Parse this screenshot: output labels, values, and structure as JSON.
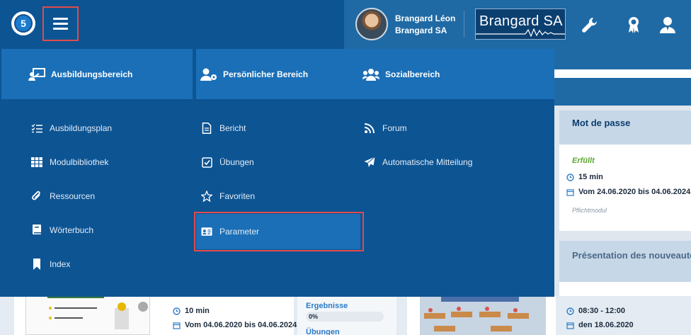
{
  "header": {
    "logo_number": "5",
    "user": {
      "name": "Brangard Léon",
      "company": "Brangard SA"
    },
    "brand_logo_text": "Brangard SA"
  },
  "menu": {
    "tabs": [
      {
        "label": "Ausbildungsbereich",
        "icon": "classroom-icon"
      },
      {
        "label": "Persönlicher Bereich",
        "icon": "user-settings-icon"
      },
      {
        "label": "Sozialbereich",
        "icon": "users-group-icon"
      }
    ],
    "columns": [
      [
        {
          "label": "Ausbildungsplan",
          "icon": "checklist-icon"
        },
        {
          "label": "Modulbibliothek",
          "icon": "grid-icon"
        },
        {
          "label": "Ressourcen",
          "icon": "paperclip-icon"
        },
        {
          "label": "Wörterbuch",
          "icon": "book-icon"
        },
        {
          "label": "Index",
          "icon": "bookmark-icon"
        }
      ],
      [
        {
          "label": "Bericht",
          "icon": "document-icon"
        },
        {
          "label": "Übungen",
          "icon": "checkbox-icon"
        },
        {
          "label": "Favoriten",
          "icon": "star-icon"
        },
        {
          "label": "Parameter",
          "icon": "id-card-icon",
          "selected": true
        }
      ],
      [
        {
          "label": "Forum",
          "icon": "rss-icon"
        },
        {
          "label": "Automatische Mitteilung",
          "icon": "paper-plane-icon"
        }
      ]
    ]
  },
  "background": {
    "card1": {
      "title": "Mot de passe",
      "status": "Erfüllt",
      "duration": "15 min",
      "dates": "Vom 24.06.2020 bis 04.06.2024",
      "type": "Pflichtmodul"
    },
    "card2": {
      "title": "Présentation des nouveautés"
    },
    "bottom_left": {
      "duration": "10 min",
      "dates": "Vom 04.06.2020 bis 04.06.2024"
    },
    "bottom_mid": {
      "results_label": "Ergebnisse",
      "progress": "0%",
      "exercises_label": "Übungen"
    },
    "bottom_right": {
      "time": "08:30 - 12:00",
      "date": "den 18.06.2020"
    }
  },
  "colors": {
    "header_dark": "#0d5493",
    "header_light": "#1f6aa5",
    "menu_tab": "#1a6fb7",
    "highlight": "#e24b4b",
    "fulfilled": "#5aa631"
  }
}
